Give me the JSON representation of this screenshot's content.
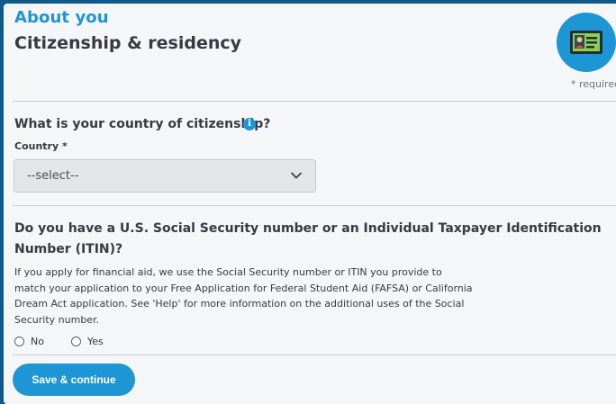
{
  "header": {
    "section": "About you",
    "title": "Citizenship & residency",
    "required_note": "* required"
  },
  "citizenship": {
    "question": "What is your country of citizenship?",
    "info_icon_glyph": "i",
    "field_label": "Country *",
    "select_value": "--select--"
  },
  "ssn": {
    "question": "Do you have a U.S. Social Security number or an Individual Taxpayer Identification Number (ITIN)?",
    "description": "If you apply for financial aid, we use the Social Security number or ITIN you provide to match your application to your Free Application for Federal Student Aid (FAFSA) or California Dream Act application. See 'Help' for more information on the additional uses of the Social Security number.",
    "options": [
      {
        "label": "No",
        "selected": false
      },
      {
        "label": "Yes",
        "selected": false
      }
    ]
  },
  "actions": {
    "save_label": "Save & continue"
  },
  "icons": {
    "badge": "id-card-icon",
    "info": "info-icon",
    "chevron": "chevron-down-icon"
  },
  "colors": {
    "accent": "#1e95d4",
    "frame": "#0f5a8a",
    "background": "#f5f6f7",
    "text": "#353b40"
  }
}
